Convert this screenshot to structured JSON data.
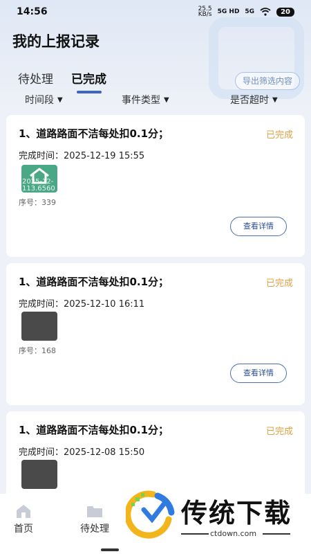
{
  "status_bar": {
    "time": "14:56",
    "net_speed": "25.5",
    "net_unit": "KB/s",
    "signal1": "5G HD",
    "signal2": "5G",
    "battery": "20"
  },
  "page": {
    "title": "我的上报记录"
  },
  "tabs": [
    {
      "label": "待处理",
      "active": false
    },
    {
      "label": "已完成",
      "active": true
    }
  ],
  "export_button": "导出筛选内容",
  "filters": [
    "时间段",
    "事件类型",
    "是否超时"
  ],
  "records": [
    {
      "title": "1、道路路面不洁每处扣0.1分；",
      "status": "已完成",
      "time_label": "完成时间：",
      "time": "2025-12-19 15:55",
      "thumb_watermark_1": "2025-12-",
      "thumb_watermark_2": "113.6560",
      "seq_label": "序号：",
      "seq": "339",
      "detail_button": "查看详情"
    },
    {
      "title": "1、道路路面不洁每处扣0.1分；",
      "status": "已完成",
      "time_label": "完成时间：",
      "time": "2025-12-10 16:11",
      "seq_label": "序号：",
      "seq": "168",
      "detail_button": "查看详情"
    },
    {
      "title": "1、道路路面不洁每处扣0.1分；",
      "status": "已完成",
      "time_label": "完成时间：",
      "time": "2025-12-08 15:50"
    }
  ],
  "bottom_nav": [
    {
      "label": "首页",
      "icon": "home-icon"
    },
    {
      "label": "待处理",
      "icon": "folder-icon"
    }
  ],
  "brand_overlay": {
    "name": "传统下载",
    "url": "ctdown.com"
  },
  "colors": {
    "accent": "#3b66c4",
    "status_done": "#e0a142",
    "detail_border": "#4b6eb4",
    "background": "#eef1f7"
  }
}
